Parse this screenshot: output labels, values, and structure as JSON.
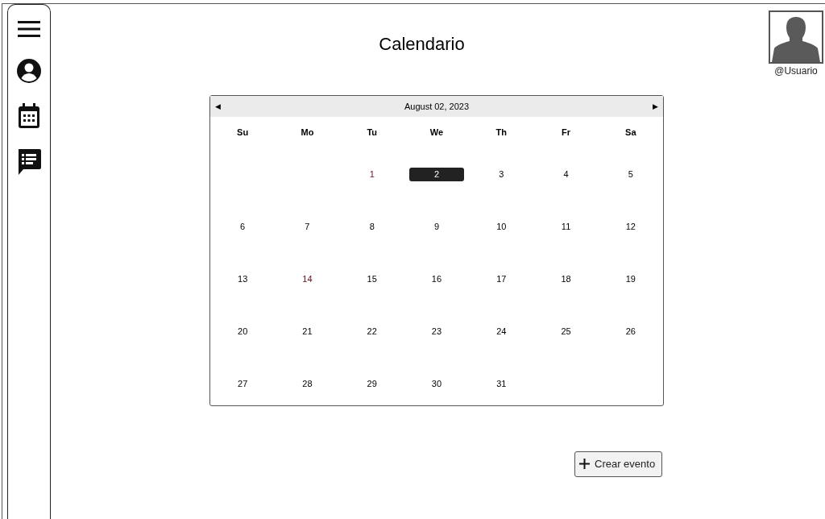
{
  "sidebar": {
    "items": [
      {
        "kind": "menu"
      },
      {
        "kind": "profile"
      },
      {
        "kind": "calendar"
      },
      {
        "kind": "messages"
      }
    ]
  },
  "title": "Calendario",
  "user": {
    "handle": "@Usuario"
  },
  "calendar": {
    "month_label": "August 02, 2023",
    "prev": "◀",
    "next": "▶",
    "weekdays": [
      "Su",
      "Mo",
      "Tu",
      "We",
      "Th",
      "Fr",
      "Sa"
    ],
    "weeks": [
      [
        {
          "kind": "blank"
        },
        {
          "kind": "blank"
        },
        {
          "kind": "day",
          "label": "1",
          "selected": false,
          "highlighted": true
        },
        {
          "kind": "day",
          "label": "2",
          "selected": true,
          "highlighted": false
        },
        {
          "kind": "day",
          "label": "3",
          "selected": false,
          "highlighted": false
        },
        {
          "kind": "day",
          "label": "4",
          "selected": false,
          "highlighted": false
        },
        {
          "kind": "day",
          "label": "5",
          "selected": false,
          "highlighted": false
        }
      ],
      [
        {
          "kind": "day",
          "label": "6",
          "selected": false,
          "highlighted": false
        },
        {
          "kind": "day",
          "label": "7",
          "selected": false,
          "highlighted": false
        },
        {
          "kind": "day",
          "label": "8",
          "selected": false,
          "highlighted": false
        },
        {
          "kind": "day",
          "label": "9",
          "selected": false,
          "highlighted": false
        },
        {
          "kind": "day",
          "label": "10",
          "selected": false,
          "highlighted": false
        },
        {
          "kind": "day",
          "label": "11",
          "selected": false,
          "highlighted": false
        },
        {
          "kind": "day",
          "label": "12",
          "selected": false,
          "highlighted": false
        }
      ],
      [
        {
          "kind": "day",
          "label": "13",
          "selected": false,
          "highlighted": false
        },
        {
          "kind": "day",
          "label": "14",
          "selected": false,
          "highlighted": true
        },
        {
          "kind": "day",
          "label": "15",
          "selected": false,
          "highlighted": false
        },
        {
          "kind": "day",
          "label": "16",
          "selected": false,
          "highlighted": false
        },
        {
          "kind": "day",
          "label": "17",
          "selected": false,
          "highlighted": false
        },
        {
          "kind": "day",
          "label": "18",
          "selected": false,
          "highlighted": false
        },
        {
          "kind": "day",
          "label": "19",
          "selected": false,
          "highlighted": false
        }
      ],
      [
        {
          "kind": "day",
          "label": "20",
          "selected": false,
          "highlighted": false
        },
        {
          "kind": "day",
          "label": "21",
          "selected": false,
          "highlighted": false
        },
        {
          "kind": "day",
          "label": "22",
          "selected": false,
          "highlighted": false
        },
        {
          "kind": "day",
          "label": "23",
          "selected": false,
          "highlighted": false
        },
        {
          "kind": "day",
          "label": "24",
          "selected": false,
          "highlighted": false
        },
        {
          "kind": "day",
          "label": "25",
          "selected": false,
          "highlighted": false
        },
        {
          "kind": "day",
          "label": "26",
          "selected": false,
          "highlighted": false
        }
      ],
      [
        {
          "kind": "day",
          "label": "27",
          "selected": false,
          "highlighted": false
        },
        {
          "kind": "day",
          "label": "28",
          "selected": false,
          "highlighted": false
        },
        {
          "kind": "day",
          "label": "29",
          "selected": false,
          "highlighted": false
        },
        {
          "kind": "day",
          "label": "30",
          "selected": false,
          "highlighted": false
        },
        {
          "kind": "day",
          "label": "31",
          "selected": false,
          "highlighted": false
        },
        {
          "kind": "blank"
        },
        {
          "kind": "blank"
        }
      ]
    ]
  },
  "create_button": {
    "label": "Crear evento"
  }
}
